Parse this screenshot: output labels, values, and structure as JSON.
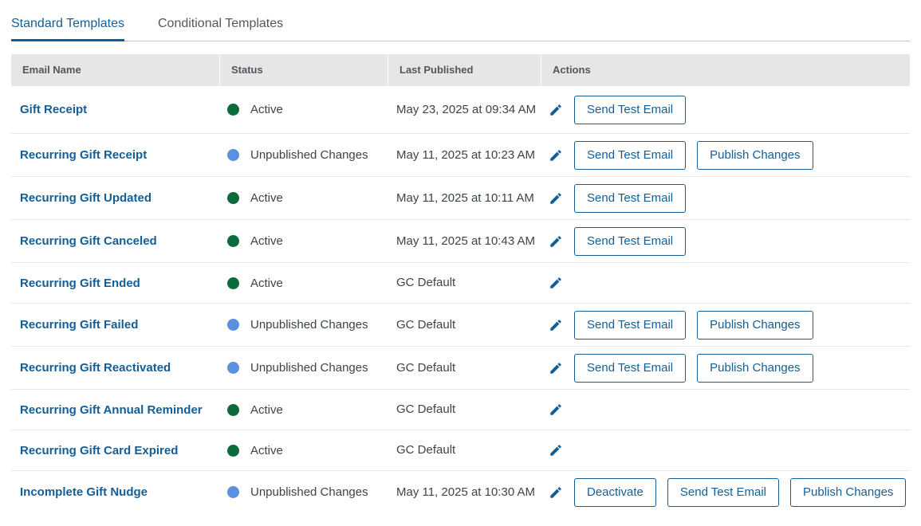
{
  "tabs": [
    {
      "label": "Standard Templates",
      "active": true
    },
    {
      "label": "Conditional Templates",
      "active": false
    }
  ],
  "table": {
    "columns": [
      "Email Name",
      "Status",
      "Last Published",
      "Actions"
    ],
    "status_colors": {
      "Active": "#0b6b3a",
      "Unpublished Changes": "#5b8fe0"
    },
    "action_labels": {
      "edit_icon": "pencil-icon",
      "deactivate": "Deactivate",
      "send_test": "Send Test Email",
      "publish": "Publish Changes"
    },
    "rows": [
      {
        "name": "Gift Receipt",
        "status": "Active",
        "last_published": "May 23, 2025 at 09:34 AM",
        "actions": [
          "send_test"
        ]
      },
      {
        "name": "Recurring Gift Receipt",
        "status": "Unpublished Changes",
        "last_published": "May 11, 2025 at 10:23 AM",
        "actions": [
          "send_test",
          "publish"
        ]
      },
      {
        "name": "Recurring Gift Updated",
        "status": "Active",
        "last_published": "May 11, 2025 at 10:11 AM",
        "actions": [
          "send_test"
        ]
      },
      {
        "name": "Recurring Gift Canceled",
        "status": "Active",
        "last_published": "May 11, 2025 at 10:43 AM",
        "actions": [
          "send_test"
        ]
      },
      {
        "name": "Recurring Gift Ended",
        "status": "Active",
        "last_published": "GC Default",
        "actions": []
      },
      {
        "name": "Recurring Gift Failed",
        "status": "Unpublished Changes",
        "last_published": "GC Default",
        "actions": [
          "send_test",
          "publish"
        ]
      },
      {
        "name": "Recurring Gift Reactivated",
        "status": "Unpublished Changes",
        "last_published": "GC Default",
        "actions": [
          "send_test",
          "publish"
        ]
      },
      {
        "name": "Recurring Gift Annual Reminder",
        "status": "Active",
        "last_published": "GC Default",
        "actions": []
      },
      {
        "name": "Recurring Gift Card Expired",
        "status": "Active",
        "last_published": "GC Default",
        "actions": []
      },
      {
        "name": "Incomplete Gift Nudge",
        "status": "Unpublished Changes",
        "last_published": "May 11, 2025 at 10:30 AM",
        "actions": [
          "deactivate",
          "send_test",
          "publish"
        ]
      }
    ]
  }
}
